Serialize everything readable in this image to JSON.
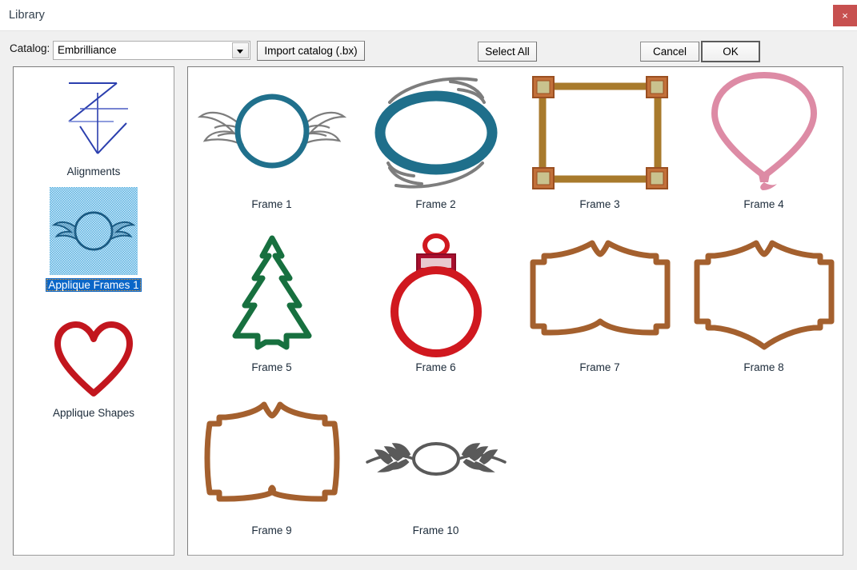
{
  "window": {
    "title": "Library",
    "close_label": "×",
    "close_icon": "close-icon"
  },
  "toolbar": {
    "catalog_label": "Catalog:",
    "catalog_value": "Embrilliance",
    "catalog_arrow_icon": "chevron-down-icon",
    "import_label": "Import catalog (.bx)",
    "select_all_label": "Select All",
    "cancel_label": "Cancel",
    "ok_label": "OK"
  },
  "sidebar": {
    "items": [
      {
        "label": "Alignments",
        "icon": "alignments-thumbnail",
        "selected": false
      },
      {
        "label": "Applique Frames 1",
        "icon": "winged-circle-thumbnail",
        "selected": true
      },
      {
        "label": "Applique Shapes",
        "icon": "heart-thumbnail",
        "selected": false
      }
    ]
  },
  "grid": {
    "items": [
      {
        "label": "Frame 1",
        "icon": "winged-circle-frame",
        "color": "#1d6e86"
      },
      {
        "label": "Frame 2",
        "icon": "swirled-oval-frame",
        "color": "#1d6e86"
      },
      {
        "label": "Frame 3",
        "icon": "rectangle-corner-frame",
        "color": "#b07d2a"
      },
      {
        "label": "Frame 4",
        "icon": "balloon-frame",
        "color": "#dd8ba5"
      },
      {
        "label": "Frame 5",
        "icon": "christmas-tree-frame",
        "color": "#17703f"
      },
      {
        "label": "Frame 6",
        "icon": "ornament-frame",
        "color": "#d0181f"
      },
      {
        "label": "Frame 7",
        "icon": "plaque-frame-flat-bottom",
        "color": "#a4602e"
      },
      {
        "label": "Frame 8",
        "icon": "plaque-frame-curved-bottom",
        "color": "#a4602e"
      },
      {
        "label": "Frame 9",
        "icon": "plaque-frame-wavy-sides",
        "color": "#a4602e"
      },
      {
        "label": "Frame 10",
        "icon": "laurel-oval-frame",
        "color": "#5a5a5a"
      }
    ]
  },
  "colors": {
    "accent": "#0a66c8",
    "close_button": "#c7504f",
    "chrome": "#f0f0f0",
    "panel": "#ffffff",
    "text": "#1c2b3a"
  }
}
